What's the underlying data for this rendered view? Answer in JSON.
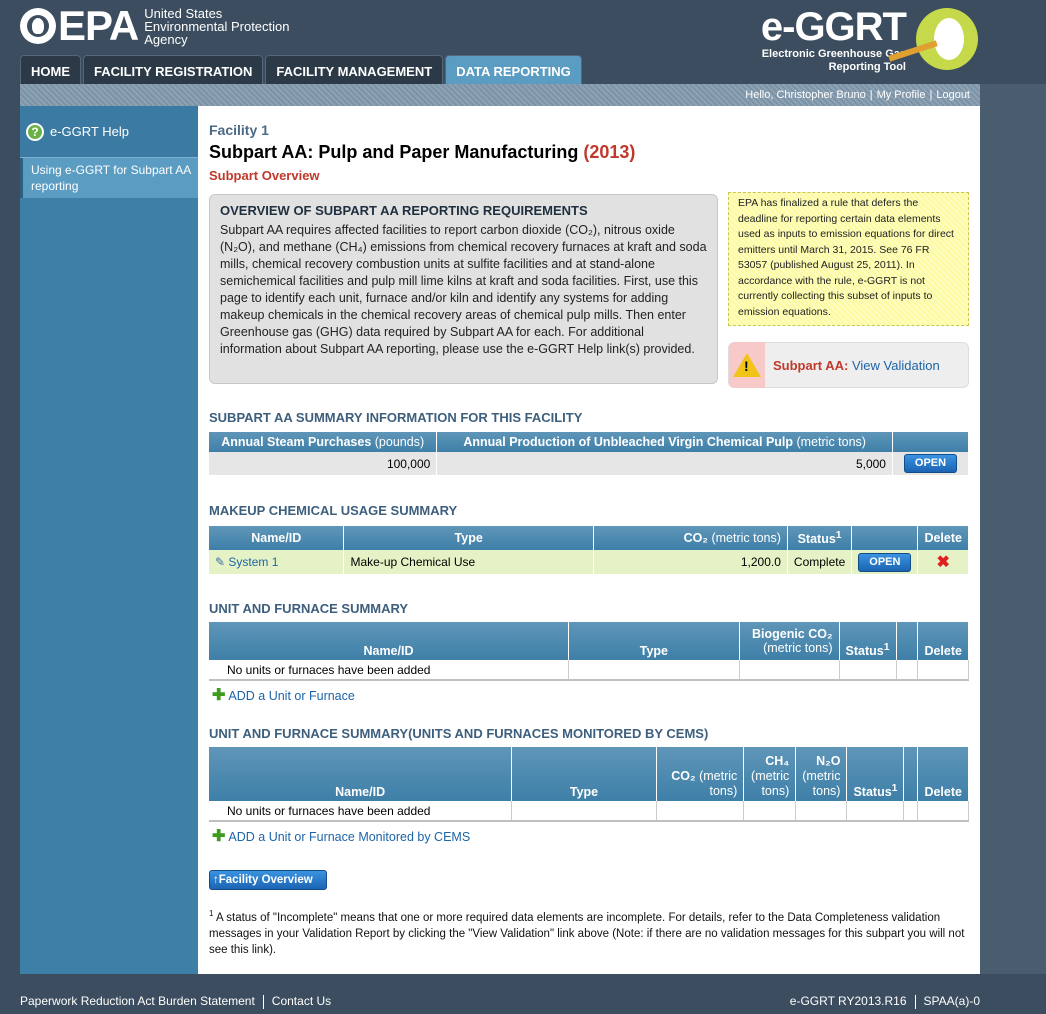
{
  "header": {
    "epa_word": "EPA",
    "agency_lines": [
      "United States",
      "Environmental Protection",
      "Agency"
    ],
    "app_title": "e-GGRT",
    "app_subtitle_lines": [
      "Electronic Greenhouse Gas",
      "Reporting Tool"
    ]
  },
  "nav": {
    "tabs": [
      "HOME",
      "FACILITY REGISTRATION",
      "FACILITY MANAGEMENT",
      "DATA REPORTING"
    ],
    "active": "DATA REPORTING"
  },
  "userbar": {
    "greeting": "Hello, Christopher Bruno",
    "profile": "My Profile",
    "logout": "Logout"
  },
  "sidebar": {
    "help": "e-GGRT Help",
    "item": "Using e-GGRT for Subpart AA reporting"
  },
  "page": {
    "facility": "Facility 1",
    "title": "Subpart AA: Pulp and Paper Manufacturing",
    "year": "(2013)",
    "overview_link": "Subpart Overview"
  },
  "overview": {
    "heading": "OVERVIEW OF SUBPART AA REPORTING REQUIREMENTS",
    "body": "Subpart AA requires affected facilities to report carbon dioxide (CO₂), nitrous oxide (N₂O), and methane (CH₄) emissions from chemical recovery furnaces at kraft and soda mills, chemical recovery combustion units at sulfite facilities and at stand-alone semichemical facilities and pulp mill lime kilns at kraft and soda facilities. First, use this page to identify each unit, furnace and/or kiln and identify any systems for adding makeup chemicals in the chemical recovery areas of chemical pulp mills. Then enter Greenhouse gas (GHG) data required by Subpart AA for each. For additional information about Subpart AA reporting, please use the e-GGRT Help link(s) provided."
  },
  "notice": "EPA has finalized a rule that defers the deadline for reporting certain data elements used as inputs to emission equations for direct emitters until March 31, 2015. See 76 FR 53057 (published August 25, 2011). In accordance with the rule, e-GGRT is not currently collecting this subset of inputs to emission equations.",
  "validation": {
    "label": "Subpart AA:",
    "link": "View Validation"
  },
  "summary": {
    "heading": "SUBPART AA SUMMARY INFORMATION FOR THIS FACILITY",
    "col1": "Annual Steam Purchases",
    "col1_unit": "(pounds)",
    "col2": "Annual Production of Unbleached Virgin Chemical Pulp",
    "col2_unit": "(metric tons)",
    "steam": "100,000",
    "pulp": "5,000",
    "button": "OPEN"
  },
  "makeup": {
    "heading": "MAKEUP CHEMICAL USAGE SUMMARY",
    "headers": [
      "Name/ID",
      "Type",
      "CO₂",
      "(metric tons)",
      "Status",
      "Delete"
    ],
    "row": {
      "name": "System 1",
      "type": "Make-up Chemical Use",
      "co2": "1,200.0",
      "status": "Complete",
      "button": "OPEN"
    }
  },
  "units": {
    "heading": "UNIT AND FURNACE SUMMARY",
    "headers": [
      "Name/ID",
      "Type",
      "Biogenic CO₂",
      "(metric tons)",
      "Status",
      "Delete"
    ],
    "empty": "No units or furnaces have been added",
    "add_link": "ADD a Unit or Furnace"
  },
  "cems": {
    "heading": "UNIT AND FURNACE SUMMARY(UNITS AND FURNACES MONITORED BY CEMS)",
    "headers": [
      "Name/ID",
      "Type",
      "CO₂",
      "(metric tons)",
      "CH₄",
      "(metric tons)",
      "N₂O",
      "(metric tons)",
      "Status",
      "Delete"
    ],
    "empty": "No units or furnaces have been added",
    "add_link": "ADD a Unit or Furnace Monitored by CEMS"
  },
  "facility_overview_button": "Facility Overview",
  "footnote": "A status of \"Incomplete\" means that one or more required data elements are incomplete. For details, refer to the Data Completeness validation messages in your Validation Report by clicking the \"View Validation\" link above (Note: if there are no validation messages for this subpart you will not see this link).",
  "footer": {
    "links": [
      "Paperwork Reduction Act Burden Statement",
      "Contact Us"
    ],
    "version": "e-GGRT RY2013.R16",
    "code": "SPAA(a)-0"
  }
}
